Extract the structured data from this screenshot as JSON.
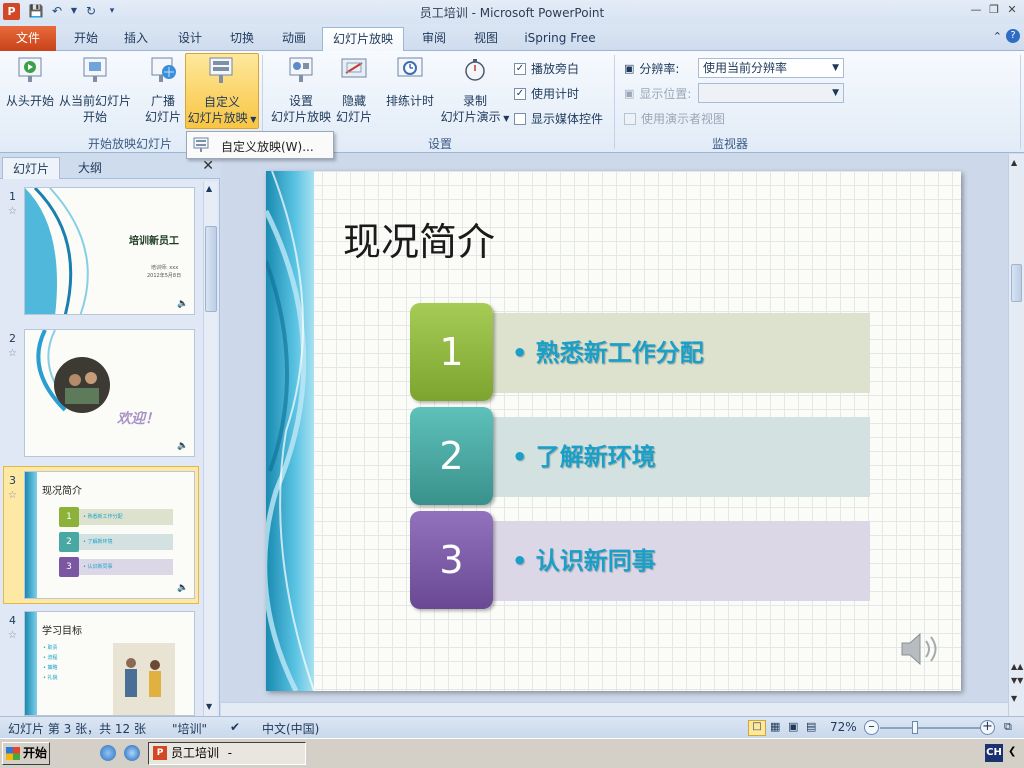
{
  "window": {
    "title": "员工培训 - Microsoft PowerPoint",
    "app_icon": "P"
  },
  "tabs": {
    "file": "文件",
    "items": [
      "开始",
      "插入",
      "设计",
      "切换",
      "动画",
      "幻灯片放映",
      "审阅",
      "视图",
      "iSpring Free"
    ],
    "active": "幻灯片放映"
  },
  "ribbon": {
    "start_group": {
      "label": "开始放映幻灯片",
      "from_beginning": "从头开始",
      "from_current_1": "从当前幻灯片",
      "from_current_2": "开始",
      "broadcast_1": "广播",
      "broadcast_2": "幻灯片",
      "custom_1": "自定义",
      "custom_2": "幻灯片放映"
    },
    "setup_group": {
      "label": "设置",
      "setup_1": "设置",
      "setup_2": "幻灯片放映",
      "hide_1": "隐藏",
      "hide_2": "幻灯片",
      "rehearse": "排练计时",
      "record_1": "录制",
      "record_2": "幻灯片演示",
      "play_narrations": "播放旁白",
      "use_timings": "使用计时",
      "show_media_controls": "显示媒体控件"
    },
    "monitors_group": {
      "label": "监视器",
      "resolution_label": "分辨率:",
      "resolution_value": "使用当前分辨率",
      "show_on_label": "显示位置:",
      "show_on_value": "",
      "presenter_view": "使用演示者视图"
    },
    "dropdown_item": "自定义放映(W)..."
  },
  "left_panel": {
    "tab_slides": "幻灯片",
    "tab_outline": "大纲",
    "thumbs": [
      {
        "num": "1",
        "title": "培训新员工",
        "sub1": "培训师: xxx",
        "sub2": "2012年5月8日"
      },
      {
        "num": "2",
        "title": "欢迎！"
      },
      {
        "num": "3",
        "title": "现况简介",
        "items": [
          "• 熟悉新工作分配",
          "• 了解新环境",
          "• 认识新同事"
        ]
      },
      {
        "num": "4",
        "title": "学习目标",
        "items": [
          "• 职责",
          "• 流程",
          "• 策略",
          "• 礼貌"
        ]
      }
    ]
  },
  "slide": {
    "title": "现况简介",
    "rows": [
      {
        "num": "1",
        "text": "• 熟悉新工作分配"
      },
      {
        "num": "2",
        "text": "• 了解新环境"
      },
      {
        "num": "3",
        "text": "• 认识新同事"
      }
    ]
  },
  "status": {
    "slide_info": "幻灯片 第 3 张，共 12 张",
    "theme": "\"培训\"",
    "language": "中文(中国)",
    "zoom": "72%"
  },
  "taskbar": {
    "start": "开始",
    "task": "员工培训 - Microsof...",
    "ime": "CH"
  },
  "colors": {
    "row1_num": "#8cb23a",
    "row1_bar": "#dde2cf",
    "row2_num": "#49a8a2",
    "row2_bar": "#d3e2e1",
    "row3_num": "#7a56a3",
    "row3_bar": "#dcd7e6",
    "accent_file_tab": "#d24726",
    "slide_band": "#1a8ab0"
  }
}
